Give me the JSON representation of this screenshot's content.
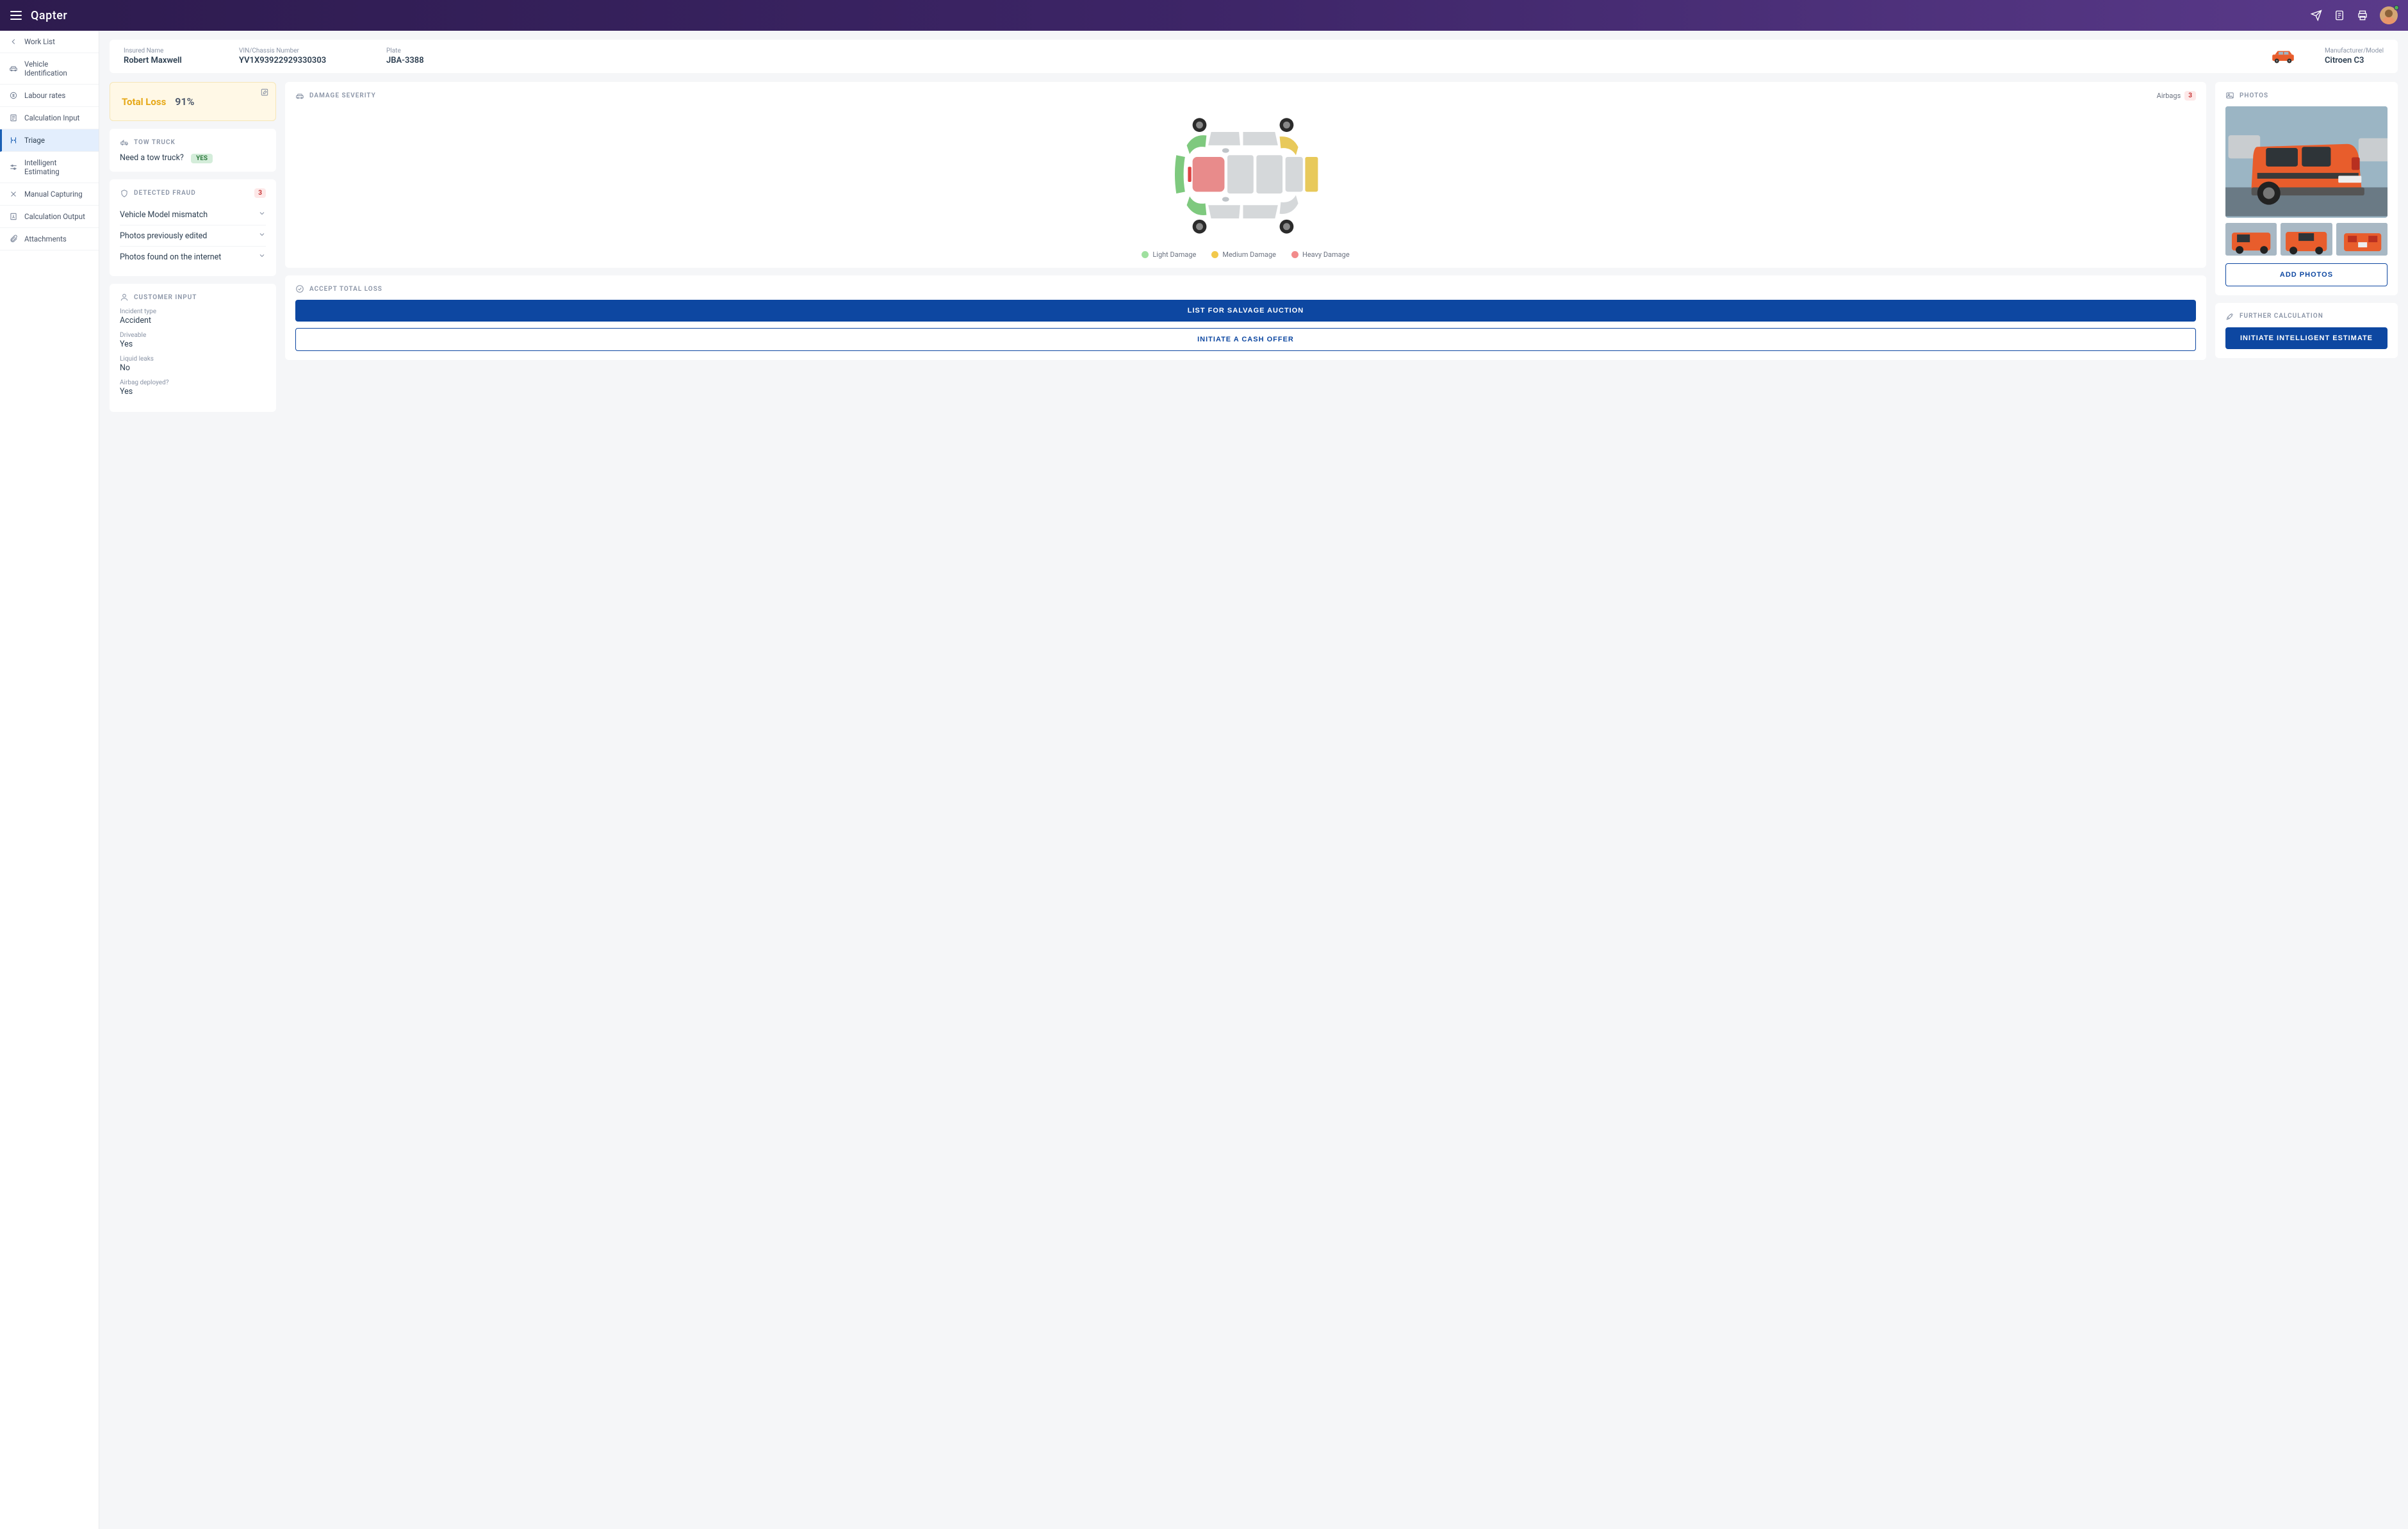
{
  "brand": "Qapter",
  "sidebar": {
    "items": [
      {
        "label": "Work List"
      },
      {
        "label": "Vehicle Identification"
      },
      {
        "label": "Labour rates"
      },
      {
        "label": "Calculation Input"
      },
      {
        "label": "Triage"
      },
      {
        "label": "Intelligent Estimating"
      },
      {
        "label": "Manual Capturing"
      },
      {
        "label": "Calculation Output"
      },
      {
        "label": "Attachments"
      }
    ]
  },
  "info": {
    "insured_label": "Insured Name",
    "insured_value": "Robert Maxwell",
    "vin_label": "VIN/Chassis Number",
    "vin_value": "YV1X93922929330303",
    "plate_label": "Plate",
    "plate_value": "JBA-3388",
    "mm_label": "Manufacturer/Model",
    "mm_value": "Citroen C3"
  },
  "total_loss": {
    "label": "Total Loss",
    "value": "91%"
  },
  "tow": {
    "title": "TOW TRUCK",
    "question": "Need a tow truck?",
    "answer": "YES"
  },
  "fraud": {
    "title": "DETECTED FRAUD",
    "count": "3",
    "items": [
      "Vehicle Model mismatch",
      "Photos previously edited",
      "Photos found on the internet"
    ]
  },
  "customer": {
    "title": "CUSTOMER INPUT",
    "rows": [
      {
        "label": "Incident type",
        "value": "Accident"
      },
      {
        "label": "Driveable",
        "value": "Yes"
      },
      {
        "label": "Liquid leaks",
        "value": "No"
      },
      {
        "label": "Airbag deployed?",
        "value": "Yes"
      }
    ]
  },
  "damage": {
    "title": "DAMAGE SEVERITY",
    "airbags_label": "Airbags",
    "airbags_count": "3",
    "legend": {
      "light": "Light Damage",
      "medium": "Medium Damage",
      "heavy": "Heavy Damage"
    }
  },
  "accept": {
    "title": "ACCEPT TOTAL LOSS",
    "primary": "LIST FOR SALVAGE AUCTION",
    "secondary": "INITIATE A CASH OFFER"
  },
  "photos": {
    "title": "PHOTOS",
    "add_button": "ADD PHOTOS"
  },
  "further": {
    "title": "FURTHER CALCULATION",
    "button": "INITIATE INTELLIGENT ESTIMATE"
  }
}
